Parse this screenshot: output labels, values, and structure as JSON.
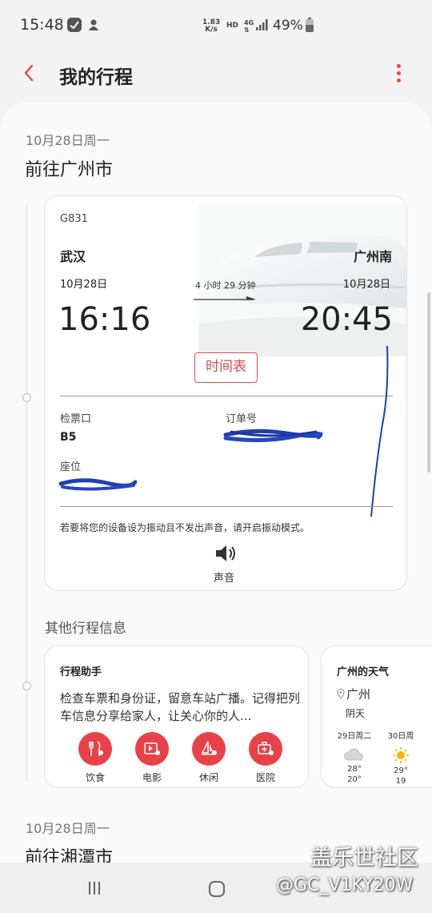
{
  "status_bar": {
    "time": "15:48",
    "net_speed": "1.83",
    "net_speed_unit": "K/s",
    "hd": "HD",
    "network": "4G",
    "battery": "49%"
  },
  "header": {
    "title": "我的行程",
    "back_icon": "chevron-left-icon",
    "more_icon": "more-vertical-icon",
    "accent": "#e0484f"
  },
  "trip1": {
    "date": "10月28日周一",
    "destination": "前往广州市"
  },
  "train": {
    "number": "G831",
    "from_station": "武汉",
    "to_station": "广州南",
    "from_date": "10月28日",
    "to_date": "10月28日",
    "duration": "4 小时 29 分钟",
    "depart_time": "16:16",
    "arrive_time": "20:45",
    "schedule_button": "时间表",
    "gate_label": "检票口",
    "gate_value": "B5",
    "order_label": "订单号",
    "seat_label": "座位",
    "vibrate_notice": "若要将您的设备设为振动且不发出声音，请开启振动模式。",
    "sound_label": "声音"
  },
  "other_info": {
    "section_title": "其他行程信息",
    "helper": {
      "title": "行程助手",
      "text": "检查车票和身份证，留意车站广播。记得把列车信息分享给家人，让关心你的人...",
      "actions": [
        {
          "label": "饮食",
          "icon": "food-icon"
        },
        {
          "label": "电影",
          "icon": "movie-icon"
        },
        {
          "label": "休闲",
          "icon": "leisure-icon"
        },
        {
          "label": "医院",
          "icon": "hospital-icon"
        }
      ]
    },
    "weather": {
      "title": "广州的天气",
      "city": "广州",
      "condition": "阴天",
      "days": [
        {
          "day": "29日周二",
          "icon": "cloudy-icon",
          "high": "28°",
          "low": "20°"
        },
        {
          "day": "30日周",
          "icon": "sunny-icon",
          "high": "29°",
          "low": "19"
        }
      ]
    }
  },
  "trip2": {
    "date": "10月28日周一",
    "destination": "前往湘潭市"
  },
  "watermark": {
    "site": "盖乐世社区",
    "user": "@GC_V1KY20W"
  }
}
